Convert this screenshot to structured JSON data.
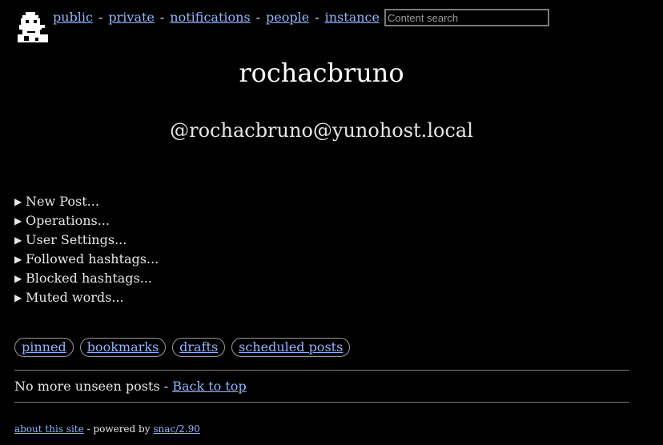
{
  "nav": {
    "links": [
      "public",
      "private",
      "notifications",
      "people",
      "instance"
    ],
    "separator": "-",
    "search_placeholder": "Content search"
  },
  "profile": {
    "name": "rochacbruno",
    "handle": "@rochacbruno@yunohost.local"
  },
  "sections": [
    "New Post...",
    "Operations...",
    "User Settings...",
    "Followed hashtags...",
    "Blocked hashtags...",
    "Muted words..."
  ],
  "tabs": [
    "pinned",
    "bookmarks",
    "drafts",
    "scheduled posts"
  ],
  "status": {
    "text": "No more unseen posts -",
    "back_to_top": "Back to top"
  },
  "footer": {
    "about": "about this site",
    "powered_by": "- powered by",
    "software": "snac/2.90"
  }
}
